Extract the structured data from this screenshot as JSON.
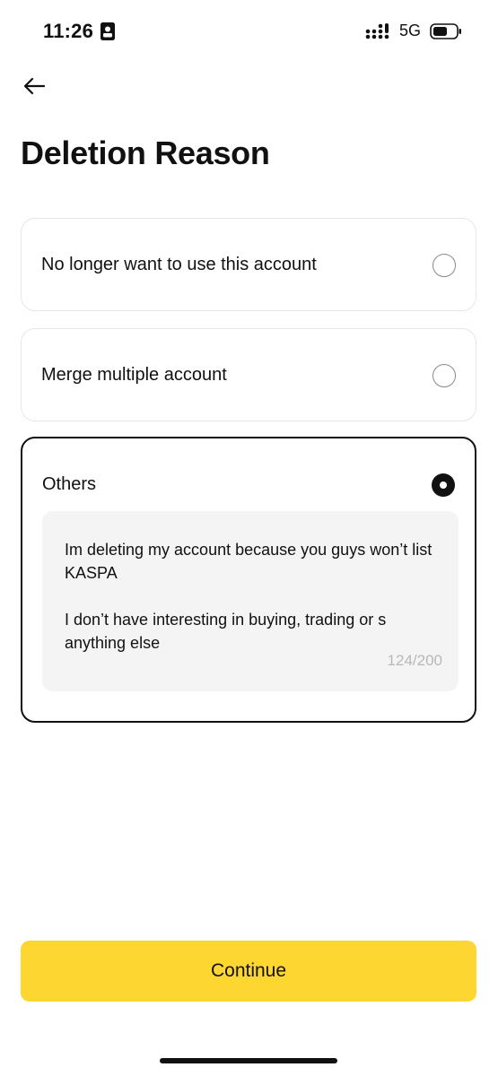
{
  "status_bar": {
    "time": "11:26",
    "network": "5G"
  },
  "page": {
    "title": "Deletion Reason"
  },
  "options": [
    {
      "label": "No longer want to use this account",
      "selected": false
    },
    {
      "label": "Merge multiple account",
      "selected": false
    },
    {
      "label": "Others",
      "selected": true
    }
  ],
  "other_reason": {
    "text": "Im deleting my account because you guys won’t list KASPA\n\nI don’t have interesting in buying, trading or s anything else",
    "char_count": "124/200"
  },
  "continue_button": {
    "label": "Continue"
  },
  "colors": {
    "accent": "#fdd631",
    "text": "#111111",
    "muted": "#b8b8b8",
    "card_border": "#e6e6e6",
    "input_bg": "#f4f4f4"
  },
  "icons": {
    "back": "arrow-left-icon",
    "id_badge": "id-badge-icon",
    "signal": "signal-icon",
    "battery": "battery-icon"
  }
}
